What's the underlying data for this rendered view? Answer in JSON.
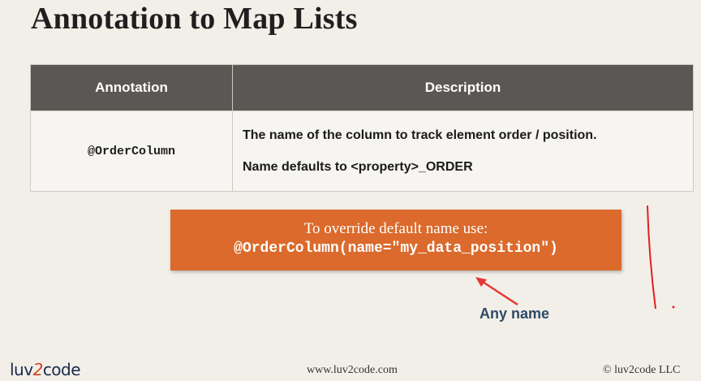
{
  "slide": {
    "title": "Annotation to Map Lists"
  },
  "table": {
    "headers": [
      "Annotation",
      "Description"
    ],
    "rows": [
      {
        "annotation": "@OrderColumn",
        "description": [
          "The name of the column to track element order / position.",
          "Name defaults to <property>_ORDER"
        ]
      }
    ]
  },
  "callout": {
    "line1": "To override default name use:",
    "line2": "@OrderColumn(name=\"my_data_position\")",
    "color": "#db6a2c"
  },
  "annotation_note": {
    "text": "Any name",
    "arrow_color": "#e53935"
  },
  "footer": {
    "logo_text_left": "luv",
    "logo_text_mid": "2",
    "logo_text_right": "code",
    "url": "www.luv2code.com",
    "copyright": "© luv2code LLC"
  }
}
